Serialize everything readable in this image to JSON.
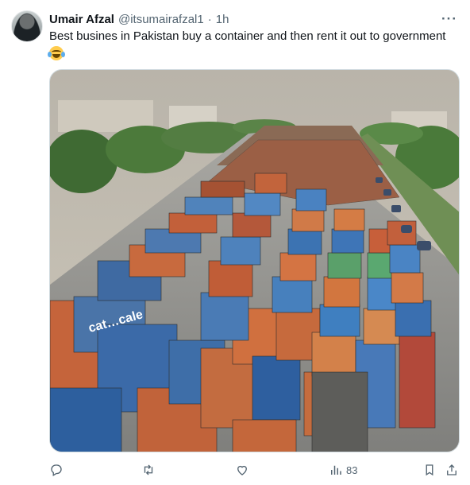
{
  "author": {
    "display_name": "Umair Afzal",
    "handle": "@itsumairafzal1",
    "separator": "·",
    "time": "1h"
  },
  "tweet": {
    "text": "Best busines in Pakistan buy a container and then rent it out to government",
    "emoji": "face-with-tears-of-joy"
  },
  "media": {
    "container_text": "cat…cale"
  },
  "actions": {
    "views": "83"
  },
  "icons": {
    "more": "more-dots-icon",
    "reply": "reply-icon",
    "retweet": "retweet-icon",
    "like": "like-icon",
    "views": "views-icon",
    "bookmark": "bookmark-icon",
    "share": "share-icon"
  },
  "colors": {
    "text": "#0f1419",
    "secondary": "#536471",
    "border": "#cfd9de"
  }
}
